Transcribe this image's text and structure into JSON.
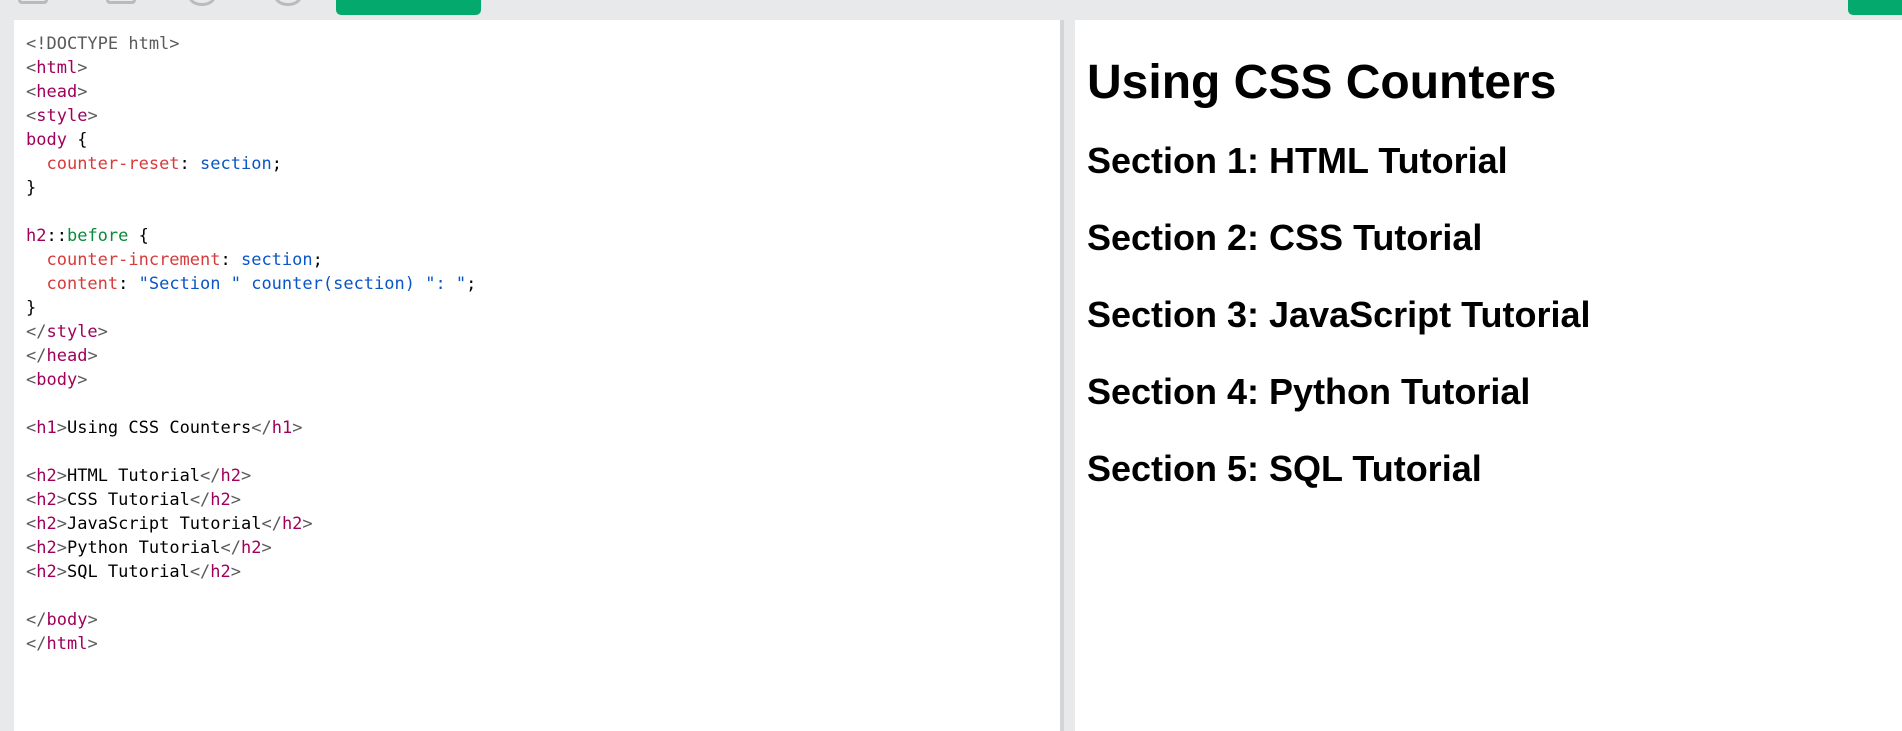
{
  "editor": {
    "lines": [
      [
        {
          "t": "<!DOCTYPE html>",
          "c": "plain-grey"
        }
      ],
      [
        {
          "t": "<",
          "c": "ang"
        },
        {
          "t": "html",
          "c": "tag"
        },
        {
          "t": ">",
          "c": "ang"
        }
      ],
      [
        {
          "t": "<",
          "c": "ang"
        },
        {
          "t": "head",
          "c": "tag"
        },
        {
          "t": ">",
          "c": "ang"
        }
      ],
      [
        {
          "t": "<",
          "c": "ang"
        },
        {
          "t": "style",
          "c": "tag"
        },
        {
          "t": ">",
          "c": "ang"
        }
      ],
      [
        {
          "t": "body",
          "c": "sel"
        },
        {
          "t": " {",
          "c": "plain"
        }
      ],
      [
        {
          "t": "  ",
          "c": "plain"
        },
        {
          "t": "counter-reset",
          "c": "prop"
        },
        {
          "t": ": ",
          "c": "plain"
        },
        {
          "t": "section",
          "c": "val"
        },
        {
          "t": ";",
          "c": "plain"
        }
      ],
      [
        {
          "t": "}",
          "c": "plain"
        }
      ],
      [
        {
          "t": "",
          "c": "plain"
        }
      ],
      [
        {
          "t": "h2",
          "c": "sel"
        },
        {
          "t": "::",
          "c": "plain"
        },
        {
          "t": "before",
          "c": "pseudo"
        },
        {
          "t": " {",
          "c": "plain"
        }
      ],
      [
        {
          "t": "  ",
          "c": "plain"
        },
        {
          "t": "counter-increment",
          "c": "prop"
        },
        {
          "t": ": ",
          "c": "plain"
        },
        {
          "t": "section",
          "c": "val"
        },
        {
          "t": ";",
          "c": "plain"
        }
      ],
      [
        {
          "t": "  ",
          "c": "plain"
        },
        {
          "t": "content",
          "c": "prop"
        },
        {
          "t": ": ",
          "c": "plain"
        },
        {
          "t": "\"Section \" counter(",
          "c": "str"
        },
        {
          "t": "section",
          "c": "val"
        },
        {
          "t": ") \": \"",
          "c": "str"
        },
        {
          "t": ";",
          "c": "plain"
        }
      ],
      [
        {
          "t": "}",
          "c": "plain"
        }
      ],
      [
        {
          "t": "</",
          "c": "ang"
        },
        {
          "t": "style",
          "c": "tag"
        },
        {
          "t": ">",
          "c": "ang"
        }
      ],
      [
        {
          "t": "</",
          "c": "ang"
        },
        {
          "t": "head",
          "c": "tag"
        },
        {
          "t": ">",
          "c": "ang"
        }
      ],
      [
        {
          "t": "<",
          "c": "ang"
        },
        {
          "t": "body",
          "c": "tag"
        },
        {
          "t": ">",
          "c": "ang"
        }
      ],
      [
        {
          "t": "",
          "c": "plain"
        }
      ],
      [
        {
          "t": "<",
          "c": "ang"
        },
        {
          "t": "h1",
          "c": "tag"
        },
        {
          "t": ">",
          "c": "ang"
        },
        {
          "t": "Using CSS Counters",
          "c": "plain"
        },
        {
          "t": "</",
          "c": "ang"
        },
        {
          "t": "h1",
          "c": "tag"
        },
        {
          "t": ">",
          "c": "ang"
        }
      ],
      [
        {
          "t": "",
          "c": "plain"
        }
      ],
      [
        {
          "t": "<",
          "c": "ang"
        },
        {
          "t": "h2",
          "c": "tag"
        },
        {
          "t": ">",
          "c": "ang"
        },
        {
          "t": "HTML Tutorial",
          "c": "plain"
        },
        {
          "t": "</",
          "c": "ang"
        },
        {
          "t": "h2",
          "c": "tag"
        },
        {
          "t": ">",
          "c": "ang"
        }
      ],
      [
        {
          "t": "<",
          "c": "ang"
        },
        {
          "t": "h2",
          "c": "tag"
        },
        {
          "t": ">",
          "c": "ang"
        },
        {
          "t": "CSS Tutorial",
          "c": "plain"
        },
        {
          "t": "</",
          "c": "ang"
        },
        {
          "t": "h2",
          "c": "tag"
        },
        {
          "t": ">",
          "c": "ang"
        }
      ],
      [
        {
          "t": "<",
          "c": "ang"
        },
        {
          "t": "h2",
          "c": "tag"
        },
        {
          "t": ">",
          "c": "ang"
        },
        {
          "t": "JavaScript Tutorial",
          "c": "plain"
        },
        {
          "t": "</",
          "c": "ang"
        },
        {
          "t": "h2",
          "c": "tag"
        },
        {
          "t": ">",
          "c": "ang"
        }
      ],
      [
        {
          "t": "<",
          "c": "ang"
        },
        {
          "t": "h2",
          "c": "tag"
        },
        {
          "t": ">",
          "c": "ang"
        },
        {
          "t": "Python Tutorial",
          "c": "plain"
        },
        {
          "t": "</",
          "c": "ang"
        },
        {
          "t": "h2",
          "c": "tag"
        },
        {
          "t": ">",
          "c": "ang"
        }
      ],
      [
        {
          "t": "<",
          "c": "ang"
        },
        {
          "t": "h2",
          "c": "tag"
        },
        {
          "t": ">",
          "c": "ang"
        },
        {
          "t": "SQL Tutorial",
          "c": "plain"
        },
        {
          "t": "</",
          "c": "ang"
        },
        {
          "t": "h2",
          "c": "tag"
        },
        {
          "t": ">",
          "c": "ang"
        }
      ],
      [
        {
          "t": "",
          "c": "plain"
        }
      ],
      [
        {
          "t": "</",
          "c": "ang"
        },
        {
          "t": "body",
          "c": "tag"
        },
        {
          "t": ">",
          "c": "ang"
        }
      ],
      [
        {
          "t": "</",
          "c": "ang"
        },
        {
          "t": "html",
          "c": "tag"
        },
        {
          "t": ">",
          "c": "ang"
        }
      ]
    ]
  },
  "preview": {
    "h1": "Using CSS Counters",
    "headings": [
      "Section 1: HTML Tutorial",
      "Section 2: CSS Tutorial",
      "Section 3: JavaScript Tutorial",
      "Section 4: Python Tutorial",
      "Section 5: SQL Tutorial"
    ]
  },
  "colors": {
    "run_button": "#04aa6d",
    "toolbar_bg": "#e7e9eb",
    "tag": "#a0005a",
    "property": "#d63a3a",
    "value": "#0a55c8",
    "pseudo": "#0a8a3a"
  }
}
